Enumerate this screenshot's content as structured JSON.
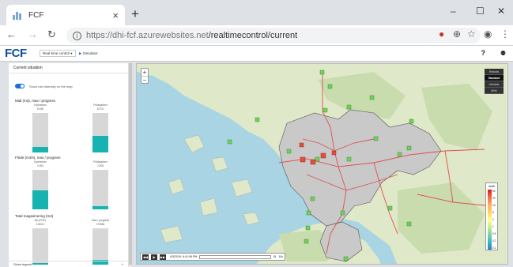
{
  "browser": {
    "tab_title": "FCF",
    "tab_close": "×",
    "new_tab": "+",
    "minimize": "–",
    "maximize": "☐",
    "close": "✕",
    "url_host": "https://dhi-fcf.azurewebsites.net",
    "url_path": "/realtimecontrol/current"
  },
  "app": {
    "logo": "FCF",
    "menu_realtime": "Real-time control",
    "menu_simulator": "Simulator",
    "help": "?",
    "user": "⚉"
  },
  "side": {
    "title": "Current situation",
    "toggle_label": "Show rain intensity on the map",
    "sections": [
      {
        "title": "Midi (m3), max / progress",
        "left": {
          "label": "Kyrkarkan",
          "value": "8 458",
          "fill": 0.14
        },
        "right": {
          "label": "Polisparken",
          "value": "8 573",
          "fill": 0.43
        }
      },
      {
        "title": "Flöde (m3/s), max / progress",
        "left": {
          "label": "Kyrkarkan",
          "value": "4.281",
          "fill": 0.48
        },
        "right": {
          "label": "Polisparken",
          "value": "2.305",
          "fill": 0.08
        }
      },
      {
        "title": "Total magasinering (m3)",
        "left": {
          "label": "Nu (FDP)",
          "value": "124211",
          "fill": 0.05
        },
        "right": {
          "label": "Max i progress",
          "value": "170584",
          "fill": 0.12
        }
      }
    ],
    "footer": "Show legend",
    "footer_chevron": "⌄"
  },
  "map": {
    "zoom_in": "+",
    "zoom_out": "−",
    "layers": [
      "Redovis",
      "Standard",
      "Urbidata",
      "Mörk"
    ],
    "selected_layer": 1,
    "legend_title": "mm/h",
    "legend_ticks": [
      "50",
      "20",
      "10",
      "5",
      "2",
      "1",
      "0.5",
      "0.2",
      "0.1"
    ],
    "legend_colors": [
      "#d7191c",
      "#f26b41",
      "#fdae61",
      "#ffd35c",
      "#ffff8c",
      "#c9ec8f",
      "#80d1a4",
      "#3db4c4",
      "#2b83ba"
    ],
    "player_time": "4/3/2019, 6:41:06 PM",
    "player_speed": "10x",
    "player_speed_icon": "⚙",
    "btn_rewind": "◀◀",
    "btn_play": "▶",
    "btn_forward": "▶▶"
  }
}
